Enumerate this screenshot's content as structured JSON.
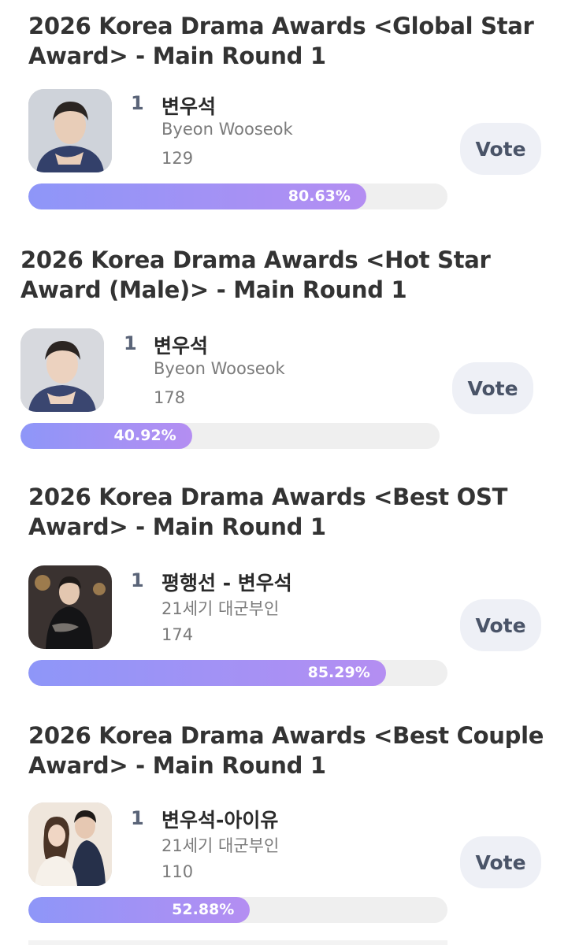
{
  "vote_label": "Vote",
  "colors": {
    "accent_start": "#8e96f8",
    "accent_end": "#b48ef2",
    "track": "#efefef",
    "button_bg": "#eef0f6"
  },
  "sections": [
    {
      "title": "2026 Korea Drama Awards <Global Star Award> - Main Round 1",
      "rank": "1",
      "name": "변우석",
      "subtitle": "Byeon Wooseok",
      "votes": "129",
      "percent_label": "80.63%",
      "percent": 80.63
    },
    {
      "title": "2026 Korea Drama Awards <Hot Star Award (Male)> - Main Round 1",
      "rank": "1",
      "name": "변우석",
      "subtitle": "Byeon Wooseok",
      "votes": "178",
      "percent_label": "40.92%",
      "percent": 40.92
    },
    {
      "title": "2026 Korea Drama Awards <Best OST Award> - Main Round 1",
      "rank": "1",
      "name": "평행선 - 변우석",
      "subtitle": "21세기 대군부인",
      "votes": "174",
      "percent_label": "85.29%",
      "percent": 85.29
    },
    {
      "title": "2026 Korea Drama Awards <Best Couple Award> - Main Round 1",
      "rank": "1",
      "name": "변우석-아이유",
      "subtitle": "21세기 대군부인",
      "votes": "110",
      "percent_label": "52.88%",
      "percent": 52.88
    }
  ]
}
